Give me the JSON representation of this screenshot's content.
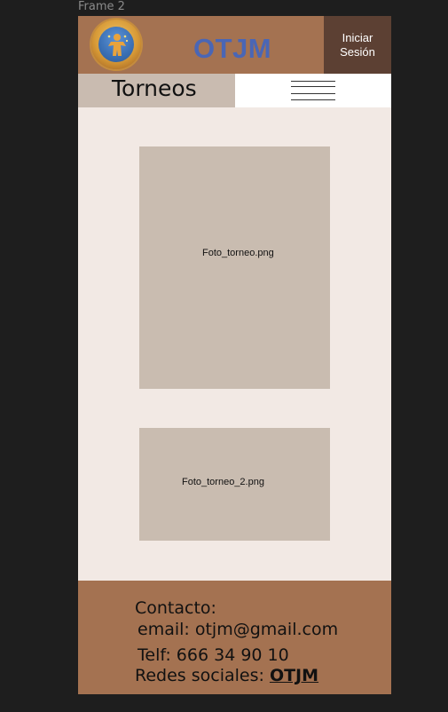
{
  "frame_label": "Frame 2",
  "header": {
    "brand": "OTJM",
    "login": "Iniciar Sesión"
  },
  "nav": {
    "title": "Torneos",
    "menu_icon": "hamburger-menu-icon"
  },
  "images": [
    {
      "label": "Foto_torneo.png"
    },
    {
      "label": "Foto_torneo_2.png"
    }
  ],
  "footer": {
    "contact_heading": "Contacto:",
    "email": "email: otjm@gmail.com",
    "phone": "Telf: 666 34 90 10",
    "social_label": "Redes sociales:",
    "social_link": "OTJM"
  },
  "colors": {
    "header_bg": "#a47251",
    "login_bg": "#5c4033",
    "brand": "#4a66b5",
    "page_bg": "#f2e9e4",
    "placeholder": "#c9bcb0"
  }
}
